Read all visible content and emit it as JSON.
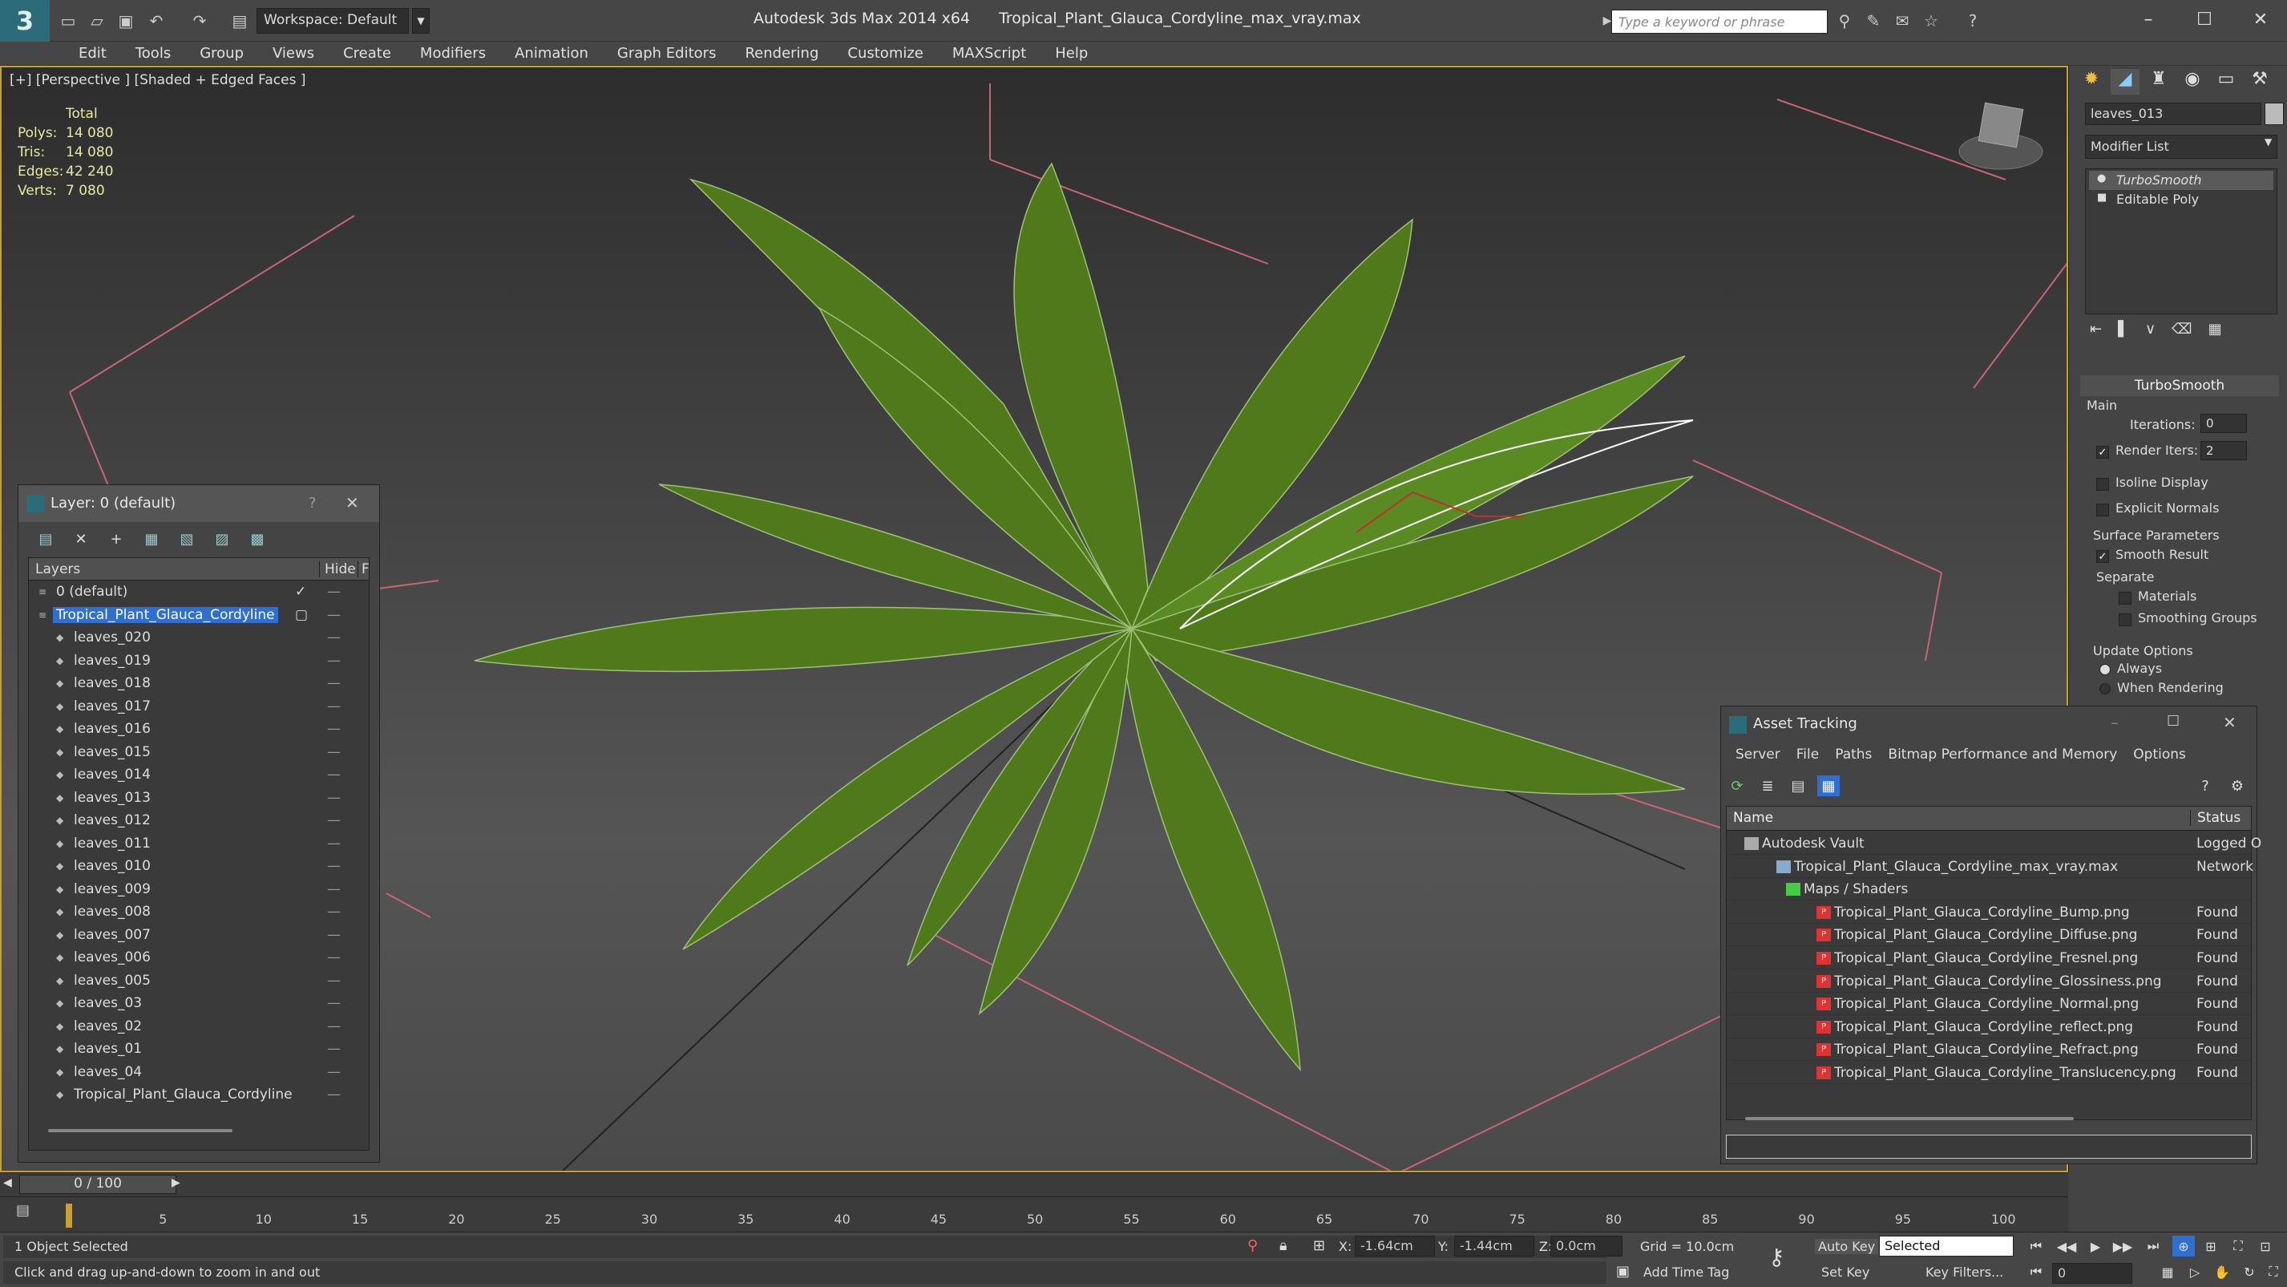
{
  "titlebar": {
    "workspace": "Workspace: Default",
    "app": "Autodesk 3ds Max  2014 x64",
    "file": "Tropical_Plant_Glauca_Cordyline_max_vray.max",
    "search_placeholder": "Type a keyword or phrase"
  },
  "menu": [
    "Edit",
    "Tools",
    "Group",
    "Views",
    "Create",
    "Modifiers",
    "Animation",
    "Graph Editors",
    "Rendering",
    "Customize",
    "MAXScript",
    "Help"
  ],
  "viewport": {
    "label": "[+] [Perspective ] [Shaded + Edged Faces ]",
    "stats": {
      "total": "Total",
      "polys_label": "Polys:",
      "polys": "14 080",
      "tris_label": "Tris:",
      "tris": "14 080",
      "edges_label": "Edges:",
      "edges": "42 240",
      "verts_label": "Verts:",
      "verts": "7 080"
    }
  },
  "layer_panel": {
    "title": "Layer: 0 (default)",
    "col_layers": "Layers",
    "col_hide": "Hide",
    "col_f": "F",
    "rows": [
      "0 (default)",
      "Tropical_Plant_Glauca_Cordyline",
      "leaves_020",
      "leaves_019",
      "leaves_018",
      "leaves_017",
      "leaves_016",
      "leaves_015",
      "leaves_014",
      "leaves_013",
      "leaves_012",
      "leaves_011",
      "leaves_010",
      "leaves_009",
      "leaves_008",
      "leaves_007",
      "leaves_006",
      "leaves_005",
      "leaves_03",
      "leaves_02",
      "leaves_01",
      "leaves_04",
      "Tropical_Plant_Glauca_Cordyline"
    ]
  },
  "command_panel": {
    "object_name": "leaves_013",
    "modifier_list": "Modifier List",
    "stack": [
      "TurboSmooth",
      "Editable Poly"
    ],
    "turbosmooth": {
      "title": "TurboSmooth",
      "main": "Main",
      "iterations_label": "Iterations:",
      "iterations": "0",
      "render_iters_label": "Render Iters:",
      "render_iters": "2",
      "isoline": "Isoline Display",
      "explicit": "Explicit Normals",
      "surface": "Surface Parameters",
      "smooth_result": "Smooth Result",
      "separate": "Separate",
      "materials": "Materials",
      "smoothing_groups": "Smoothing Groups",
      "update_options": "Update Options",
      "always": "Always",
      "when_rendering": "When Rendering"
    }
  },
  "asset_tracking": {
    "title": "Asset Tracking",
    "menu": [
      "Server",
      "File",
      "Paths",
      "Bitmap Performance and Memory",
      "Options"
    ],
    "col_name": "Name",
    "col_status": "Status",
    "rows": [
      {
        "name": "Autodesk Vault",
        "status": "Logged O"
      },
      {
        "name": "Tropical_Plant_Glauca_Cordyline_max_vray.max",
        "status": "Network"
      },
      {
        "name": "Maps / Shaders",
        "status": ""
      },
      {
        "name": "Tropical_Plant_Glauca_Cordyline_Bump.png",
        "status": "Found"
      },
      {
        "name": "Tropical_Plant_Glauca_Cordyline_Diffuse.png",
        "status": "Found"
      },
      {
        "name": "Tropical_Plant_Glauca_Cordyline_Fresnel.png",
        "status": "Found"
      },
      {
        "name": "Tropical_Plant_Glauca_Cordyline_Glossiness.png",
        "status": "Found"
      },
      {
        "name": "Tropical_Plant_Glauca_Cordyline_Normal.png",
        "status": "Found"
      },
      {
        "name": "Tropical_Plant_Glauca_Cordyline_reflect.png",
        "status": "Found"
      },
      {
        "name": "Tropical_Plant_Glauca_Cordyline_Refract.png",
        "status": "Found"
      },
      {
        "name": "Tropical_Plant_Glauca_Cordyline_Translucency.png",
        "status": "Found"
      }
    ]
  },
  "timeline": {
    "frame": "0 / 100",
    "ticks": [
      "5",
      "10",
      "15",
      "20",
      "25",
      "30",
      "35",
      "40",
      "45",
      "50",
      "55",
      "60",
      "65",
      "70",
      "75",
      "80",
      "85",
      "90",
      "95",
      "100"
    ]
  },
  "status": {
    "selected": "1 Object Selected",
    "prompt": "Click and drag up-and-down to zoom in and out",
    "x_label": "X:",
    "x": "-1.64cm",
    "y_label": "Y:",
    "y": "-1.44cm",
    "z_label": "Z:",
    "z": "0.0cm",
    "grid": "Grid = 10.0cm",
    "auto_key": "Auto Key",
    "set_key": "Set Key",
    "selected_dropdown": "Selected",
    "key_filters": "Key Filters...",
    "add_time_tag": "Add Time Tag",
    "frame_value": "0"
  },
  "colors": {
    "selection_blue": "#2e6fd1",
    "viewport_border": "#c8a030",
    "leaf_green": "#4e7a1a"
  }
}
